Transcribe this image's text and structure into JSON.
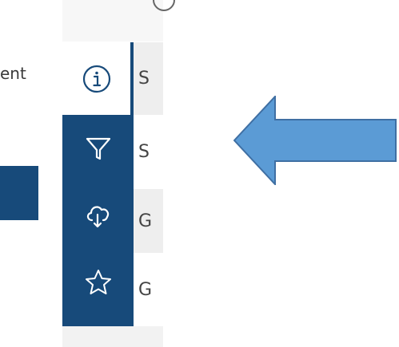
{
  "left_panel": {
    "partial_text": "ent"
  },
  "rail": {
    "items": [
      {
        "name": "info",
        "icon": "info-icon",
        "active": true
      },
      {
        "name": "filter",
        "icon": "filter-icon",
        "active": false
      },
      {
        "name": "download",
        "icon": "cloud-download-icon",
        "active": false
      },
      {
        "name": "favorites",
        "icon": "star-icon",
        "active": false
      }
    ]
  },
  "list": {
    "rows": [
      {
        "text": "S"
      },
      {
        "text": "S"
      },
      {
        "text": "G"
      },
      {
        "text": "G"
      }
    ]
  },
  "annotation": {
    "arrow_color": "#5b9bd5",
    "arrow_direction": "left"
  },
  "colors": {
    "rail": "#174a7a",
    "accent_white": "#ffffff"
  }
}
